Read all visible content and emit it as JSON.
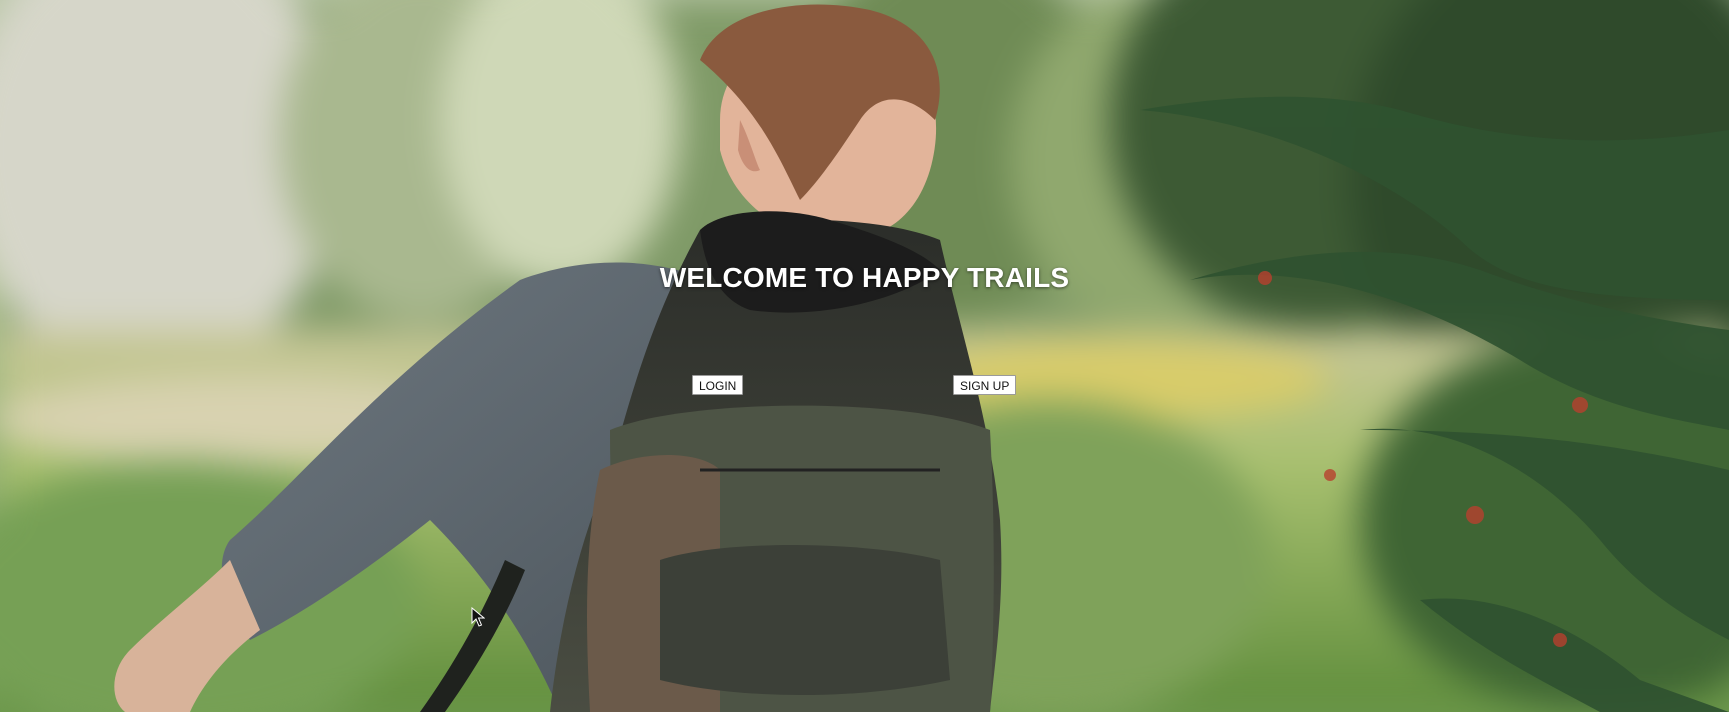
{
  "hero": {
    "title": "WELCOME TO HAPPY TRAILS"
  },
  "actions": {
    "login_label": "LOGIN",
    "signup_label": "SIGN UP"
  },
  "background": {
    "description_icon": "hiker-photo",
    "colors": {
      "foliage_dark": "#2e4a2a",
      "foliage_light": "#8fae6a",
      "meadow": "#9fbc6e",
      "shirt": "#5e6870",
      "backpack": "#3b3f36"
    }
  },
  "cursor": {
    "icon": "mouse-pointer-icon"
  }
}
